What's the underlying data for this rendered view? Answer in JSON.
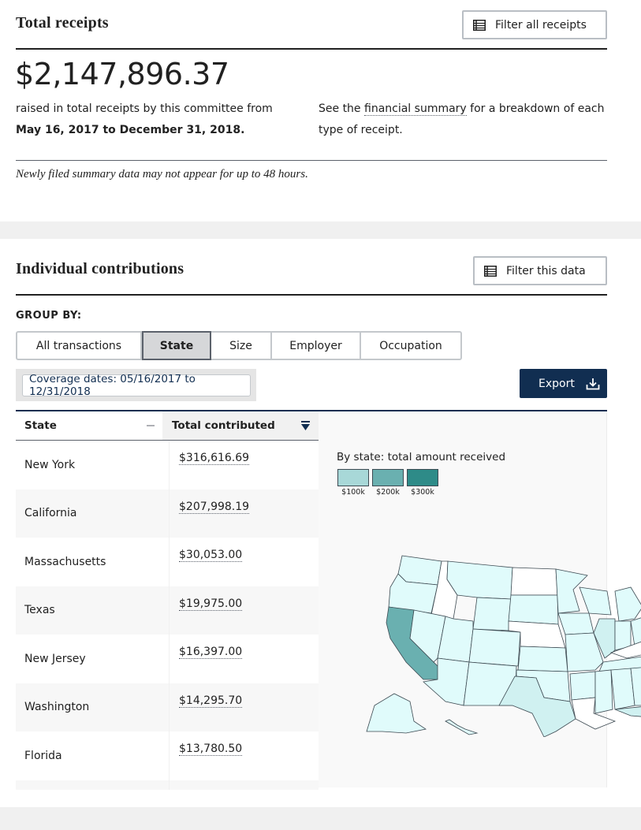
{
  "receipts": {
    "title": "Total receipts",
    "filter_button": "Filter all receipts",
    "total": "$2,147,896.37",
    "desc_prefix": "raised in total receipts by this committee from ",
    "desc_dates": "May 16, 2017 to December 31, 2018.",
    "see_prefix": "See the ",
    "see_link": "financial summary",
    "see_suffix": " for a breakdown of each type of receipt.",
    "note": "Newly filed summary data may not appear for up to 48 hours."
  },
  "contributions": {
    "title": "Individual contributions",
    "filter_button": "Filter this data",
    "group_by_label": "GROUP BY:",
    "group_by_options": [
      "All transactions",
      "State",
      "Size",
      "Employer",
      "Occupation"
    ],
    "group_by_selected": "State",
    "coverage": "Coverage dates: 05/16/2017 to 12/31/2018",
    "export_label": "Export",
    "table": {
      "columns": [
        "State",
        "Total contributed"
      ],
      "sorted_column": "Total contributed",
      "sort_direction": "descending",
      "rows": [
        {
          "state": "New York",
          "total": "$316,616.69"
        },
        {
          "state": "California",
          "total": "$207,998.19"
        },
        {
          "state": "Massachusetts",
          "total": "$30,053.00"
        },
        {
          "state": "Texas",
          "total": "$19,975.00"
        },
        {
          "state": "New Jersey",
          "total": "$16,397.00"
        },
        {
          "state": "Washington",
          "total": "$14,295.70"
        },
        {
          "state": "Florida",
          "total": "$13,780.50"
        }
      ]
    },
    "map": {
      "title": "By state: total amount received",
      "legend": [
        {
          "label": "$100k",
          "color": "#a8d8d8"
        },
        {
          "label": "$200k",
          "color": "#6ab0b0"
        },
        {
          "label": "$300k",
          "color": "#2e8b88"
        }
      ],
      "colors": {
        "none": "#ffffff",
        "low": "#e0fbfb",
        "mid_low": "#d0f1f1",
        "ca": "#6ab0b0",
        "ny": "#2e8b88",
        "stroke": "#3d4a52"
      }
    }
  },
  "colors": {
    "navy": "#112e51",
    "band": "#f0f0f0"
  }
}
